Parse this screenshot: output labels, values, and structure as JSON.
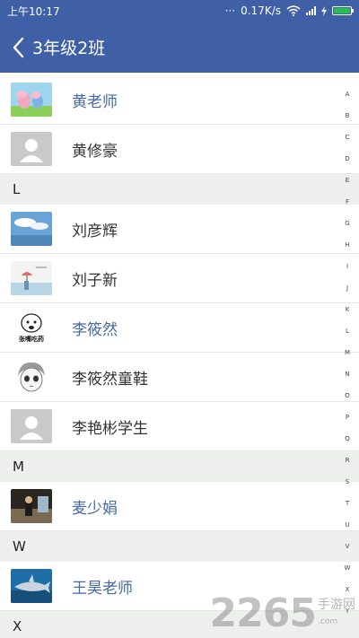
{
  "statusbar": {
    "time": "上午10:17",
    "dots": "···",
    "speed": "0.17K/s"
  },
  "header": {
    "title": "3年级2班"
  },
  "sections": {
    "L": "L",
    "M": "M",
    "W": "W",
    "X": "X"
  },
  "contacts": [
    {
      "name": "黄老师",
      "highlight": true,
      "avatar": "peppa-pig-icon"
    },
    {
      "name": "黄修豪",
      "highlight": false,
      "avatar": "default-avatar-icon"
    },
    {
      "name": "刘彦辉",
      "highlight": false,
      "avatar": "sky-photo"
    },
    {
      "name": "刘子新",
      "highlight": false,
      "avatar": "umbrella-photo"
    },
    {
      "name": "李筱然",
      "highlight": true,
      "avatar": "cartoon-face",
      "avatar_caption": "张嘴吃药"
    },
    {
      "name": "李筱然童鞋",
      "highlight": false,
      "avatar": "anime-face"
    },
    {
      "name": "李艳彬学生",
      "highlight": false,
      "avatar": "default-avatar-icon"
    },
    {
      "name": "麦少娟",
      "highlight": true,
      "avatar": "person-photo"
    },
    {
      "name": "王昊老师",
      "highlight": true,
      "avatar": "shark-photo"
    }
  ],
  "index": [
    "A",
    "B",
    "C",
    "D",
    "E",
    "F",
    "G",
    "H",
    "I",
    "J",
    "K",
    "L",
    "M",
    "N",
    "O",
    "P",
    "Q",
    "R",
    "S",
    "T",
    "U",
    "V",
    "W",
    "X",
    "Y"
  ],
  "watermark": {
    "number": "2265",
    "suffix": "手游网",
    "suffix_url": ".com"
  },
  "colors": {
    "header": "#3f5fa6",
    "highlight_name": "#4667a6",
    "section_bg": "#eef0ee"
  }
}
